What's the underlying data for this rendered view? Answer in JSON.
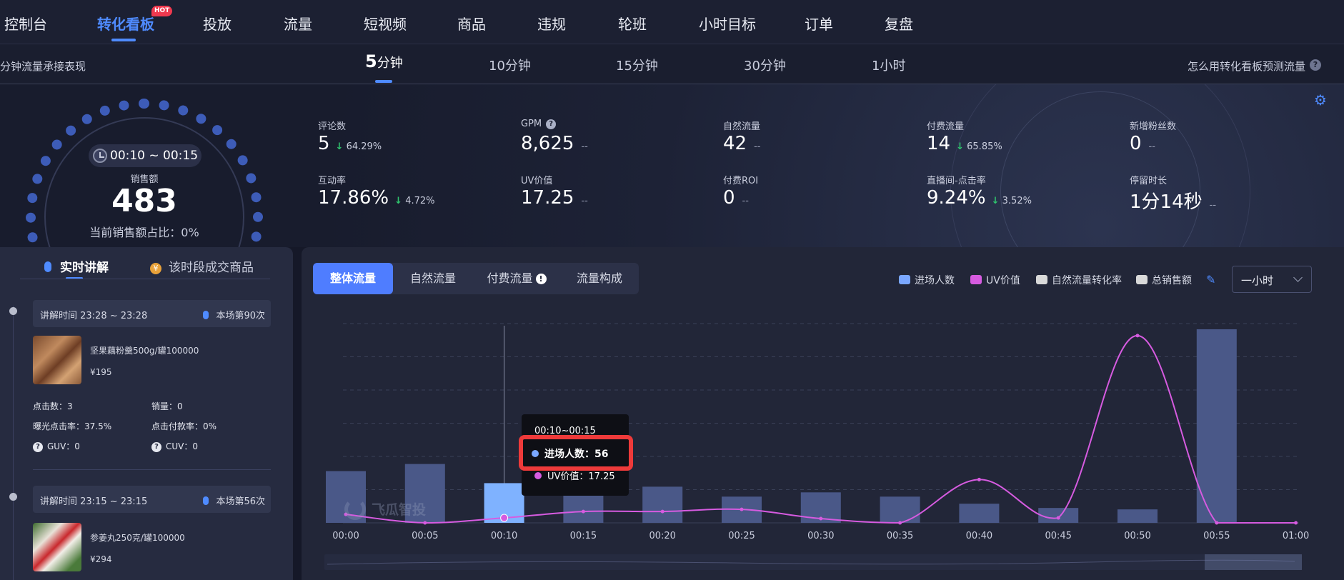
{
  "nav": {
    "items": [
      "控制台",
      "转化看板",
      "投放",
      "流量",
      "短视频",
      "商品",
      "违规",
      "轮班",
      "小时目标",
      "订单",
      "复盘"
    ],
    "active_index": 1,
    "hot_badge": "HOT"
  },
  "subheader": {
    "title": "分钟流量承接表现",
    "intervals": [
      {
        "num": "5",
        "unit": "分钟"
      },
      {
        "num": "10",
        "unit": "分钟"
      },
      {
        "num": "15",
        "unit": "分钟"
      },
      {
        "num": "30",
        "unit": "分钟"
      },
      {
        "num": "1",
        "unit": "小时"
      }
    ],
    "active_interval": 0,
    "help_link": "怎么用转化看板预测流量",
    "help_icon": "?"
  },
  "overview": {
    "time_range": "00:10 ~ 00:15",
    "sales_label": "销售额",
    "sales_value": "483",
    "sales_share": "当前销售额占比：0%"
  },
  "metrics": [
    {
      "label": "评论数",
      "value": "5",
      "change": "64.29%",
      "has_change": true
    },
    {
      "label": "GPM",
      "value": "8,625",
      "dash": "--",
      "has_help": true
    },
    {
      "label": "自然流量",
      "value": "42",
      "dash": "--"
    },
    {
      "label": "付费流量",
      "value": "14",
      "change": "65.85%",
      "has_change": true
    },
    {
      "label": "新增粉丝数",
      "value": "0",
      "dash": "--"
    },
    {
      "label": "互动率",
      "value": "17.86%",
      "change": "4.72%",
      "has_change": true
    },
    {
      "label": "UV价值",
      "value": "17.25",
      "dash": "--"
    },
    {
      "label": "付费ROI",
      "value": "0",
      "dash": "--"
    },
    {
      "label": "直播间-点击率",
      "value": "9.24%",
      "change": "3.52%",
      "has_change": true
    },
    {
      "label": "停留时长",
      "value": "1分14秒",
      "dash": "--"
    }
  ],
  "left_panel": {
    "tabs": [
      "实时讲解",
      "该时段成交商品"
    ],
    "coin_glyph": "¥",
    "sessions": [
      {
        "time": "讲解时间 23:28 ~ 23:28",
        "count": "本场第90次",
        "product_name": "坚果藕粉羹500g/罐100000",
        "price": "¥195",
        "clicks": "点击数：3",
        "sales": "销量：0",
        "ctr": "曝光点击率：37.5%",
        "cvr": "点击付款率：0%",
        "guv": "GUV：0",
        "cuv": "CUV：0"
      },
      {
        "time": "讲解时间 23:15 ~ 23:15",
        "count": "本场第56次",
        "product_name": "参姜丸250克/罐100000",
        "price": "¥294"
      }
    ]
  },
  "chart_panel": {
    "segments": [
      "整体流量",
      "自然流量",
      "付费流量",
      "流量构成"
    ],
    "active_segment": 0,
    "legend": [
      {
        "name": "进场人数",
        "color": "#7aa7ff"
      },
      {
        "name": "UV价值",
        "color": "#d65be0"
      },
      {
        "name": "自然流量转化率",
        "color": "#d9d9d9"
      },
      {
        "name": "总销售额",
        "color": "#d9d9d9"
      }
    ],
    "range_select": "一小时",
    "watermark": "飞瓜智投",
    "tooltip": {
      "time": "00:10~00:15",
      "row1": "进场人数：56",
      "row2": "UV价值：17.25"
    }
  },
  "chart_data": {
    "type": "bar",
    "categories": [
      "00:00",
      "00:05",
      "00:10",
      "00:15",
      "00:20",
      "00:25",
      "00:30",
      "00:35",
      "00:40",
      "00:45",
      "00:50",
      "00:55",
      "01:00"
    ],
    "series": [
      {
        "name": "进场人数",
        "type": "bar",
        "values": [
          73,
          83,
          56,
          45,
          51,
          37,
          43,
          37,
          27,
          21,
          19,
          273,
          null
        ]
      },
      {
        "name": "UV价值",
        "type": "line",
        "values": [
          12,
          0,
          7,
          16,
          16,
          19,
          6,
          0,
          61,
          7,
          264,
          0,
          0
        ]
      }
    ],
    "highlight_index": 2,
    "colors": {
      "bar": "#4a5888",
      "bar_highlight": "#7fb2ff",
      "line": "#d65be0"
    },
    "grid": true
  }
}
